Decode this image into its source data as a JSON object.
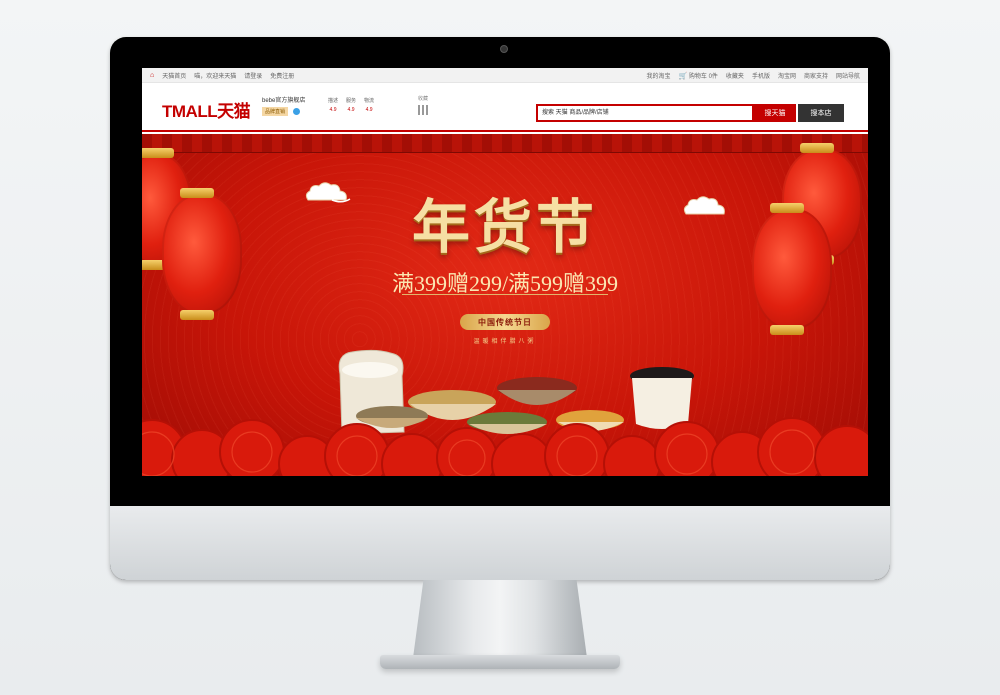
{
  "topbar": {
    "left_items": [
      "天猫首页",
      "喵，欢迎来天猫",
      "请登录",
      "免费注册"
    ],
    "right_items": [
      "我的淘宝",
      "购物车 0件",
      "收藏夹",
      "手机版",
      "淘宝网",
      "商家支持",
      "网站导航"
    ]
  },
  "header": {
    "logo": "TMALL天猫",
    "shop_name": "bebe官方旗舰店",
    "shop_badge": "品牌直销",
    "ratings": [
      {
        "label": "描述",
        "value": "4.9"
      },
      {
        "label": "服务",
        "value": "4.9"
      },
      {
        "label": "物流",
        "value": "4.9"
      }
    ],
    "collect_label": "收藏",
    "search_placeholder": "搜索 天猫 商品/品牌/店铺",
    "search_tmall_button": "搜天猫",
    "search_shop_button": "搜本店"
  },
  "banner": {
    "title": "年货节",
    "promo": "满399赠299/满599赠399",
    "tag": "中国传统节日",
    "subtag": "温暖相伴腊八粥"
  },
  "colors": {
    "brand_red": "#c40000",
    "banner_red": "#d11a0b",
    "gold": "#f6dfa3"
  }
}
